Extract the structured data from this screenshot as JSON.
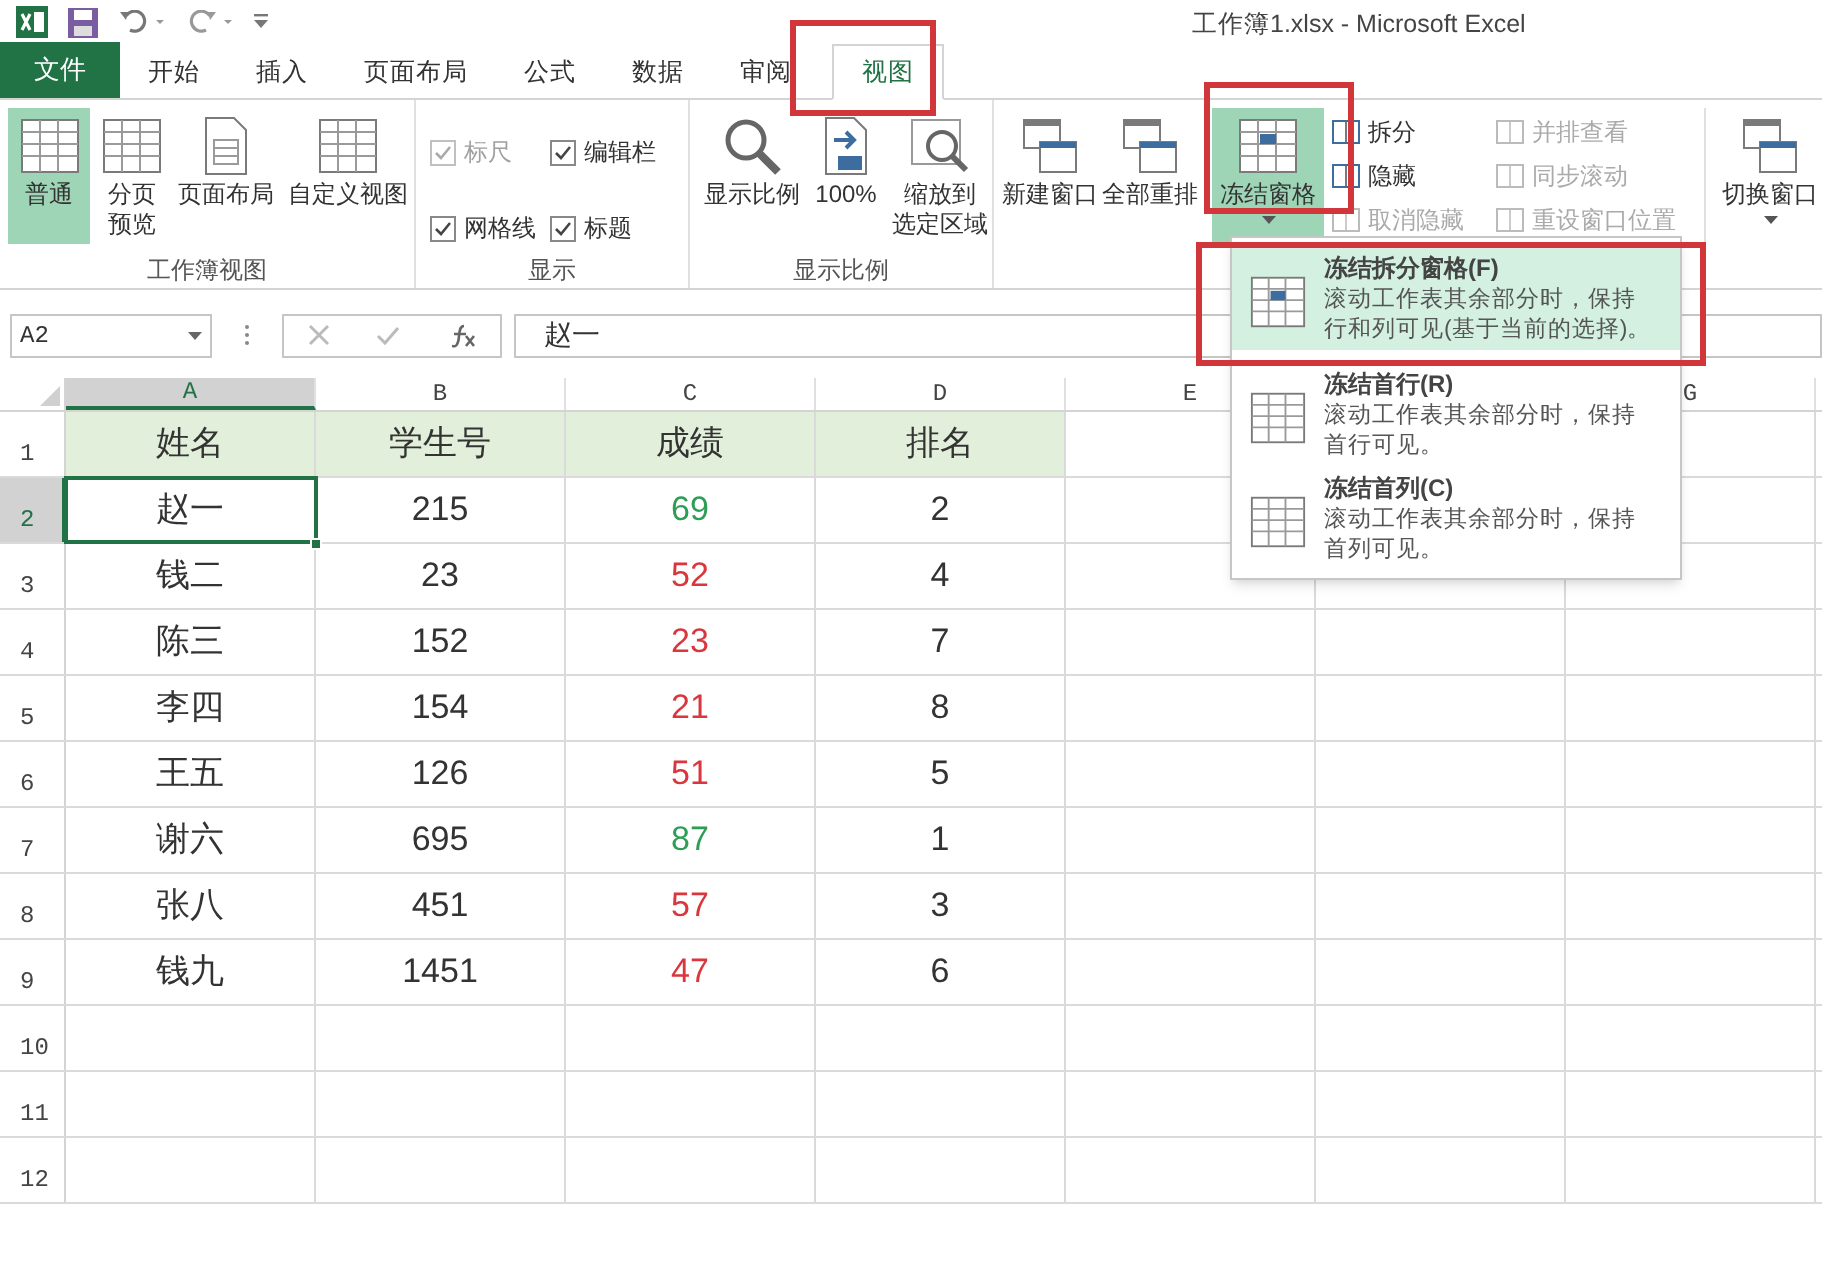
{
  "window": {
    "title": "工作簿1.xlsx - Microsoft Excel"
  },
  "tabs": [
    {
      "label": "文件",
      "kind": "file",
      "selected": false
    },
    {
      "label": "开始",
      "kind": "tab",
      "selected": false
    },
    {
      "label": "插入",
      "kind": "tab",
      "selected": false
    },
    {
      "label": "页面布局",
      "kind": "tab",
      "selected": false
    },
    {
      "label": "公式",
      "kind": "tab",
      "selected": false
    },
    {
      "label": "数据",
      "kind": "tab",
      "selected": false
    },
    {
      "label": "审阅",
      "kind": "tab",
      "selected": false
    },
    {
      "label": "视图",
      "kind": "tab",
      "selected": true
    }
  ],
  "ribbon": {
    "workbook_views": {
      "label": "工作簿视图",
      "buttons": [
        {
          "label": "普通",
          "selected": true
        },
        {
          "lines": [
            "分页",
            "预览"
          ],
          "selected": false
        },
        {
          "label": "页面布局",
          "selected": false
        },
        {
          "label": "自定义视图",
          "selected": false
        }
      ]
    },
    "show": {
      "label": "显示",
      "checkboxes": [
        {
          "label": "标尺",
          "checked": true,
          "disabled": true
        },
        {
          "label": "编辑栏",
          "checked": true,
          "disabled": false
        },
        {
          "label": "网格线",
          "checked": true,
          "disabled": false
        },
        {
          "label": "标题",
          "checked": true,
          "disabled": false
        }
      ]
    },
    "zoom": {
      "label": "显示比例",
      "buttons": [
        {
          "label": "显示比例"
        },
        {
          "label": "100%"
        },
        {
          "lines": [
            "缩放到",
            "选定区域"
          ]
        }
      ]
    },
    "window": {
      "buttons": [
        {
          "label": "新建窗口",
          "expanded": false
        },
        {
          "label": "全部重排",
          "expanded": false
        },
        {
          "label": "冻结窗格",
          "expanded": true
        }
      ],
      "small_left": [
        {
          "label": "拆分",
          "disabled": false
        },
        {
          "label": "隐藏",
          "disabled": false
        },
        {
          "label": "取消隐藏",
          "disabled": true
        }
      ],
      "small_right": [
        {
          "label": "并排查看",
          "disabled": true
        },
        {
          "label": "同步滚动",
          "disabled": true
        },
        {
          "label": "重设窗口位置",
          "disabled": true
        }
      ],
      "switch": {
        "label": "切换窗口"
      }
    }
  },
  "formula_bar": {
    "name_box": "A2",
    "value": "赵一"
  },
  "columns": [
    {
      "label": "A",
      "selected": true
    },
    {
      "label": "B",
      "selected": false
    },
    {
      "label": "C",
      "selected": false
    },
    {
      "label": "D",
      "selected": false
    },
    {
      "label": "E",
      "selected": false
    },
    {
      "label": "G",
      "selected": false
    }
  ],
  "rows": [
    {
      "row": "1",
      "kind": "header",
      "cells": [
        "姓名",
        "学生号",
        "成绩",
        "排名"
      ],
      "selected": false
    },
    {
      "row": "2",
      "kind": "data",
      "cells": [
        "赵一",
        "215",
        "69",
        "2"
      ],
      "color": "#2e9e57",
      "selected": true
    },
    {
      "row": "3",
      "kind": "data",
      "cells": [
        "钱二",
        "23",
        "52",
        "4"
      ],
      "color": "#d9363e",
      "selected": false
    },
    {
      "row": "4",
      "kind": "data",
      "cells": [
        "陈三",
        "152",
        "23",
        "7"
      ],
      "color": "#d9363e",
      "selected": false
    },
    {
      "row": "5",
      "kind": "data",
      "cells": [
        "李四",
        "154",
        "21",
        "8"
      ],
      "color": "#d9363e",
      "selected": false
    },
    {
      "row": "6",
      "kind": "data",
      "cells": [
        "王五",
        "126",
        "51",
        "5"
      ],
      "color": "#d9363e",
      "selected": false
    },
    {
      "row": "7",
      "kind": "data",
      "cells": [
        "谢六",
        "695",
        "87",
        "1"
      ],
      "color": "#2e9e57",
      "selected": false
    },
    {
      "row": "8",
      "kind": "data",
      "cells": [
        "张八",
        "451",
        "57",
        "3"
      ],
      "color": "#d9363e",
      "selected": false
    },
    {
      "row": "9",
      "kind": "data",
      "cells": [
        "钱九",
        "1451",
        "47",
        "6"
      ],
      "color": "#d9363e",
      "selected": false
    },
    {
      "row": "10",
      "kind": "empty",
      "selected": false
    },
    {
      "row": "11",
      "kind": "empty",
      "selected": false
    },
    {
      "row": "12",
      "kind": "empty",
      "selected": false
    }
  ],
  "freeze_menu": [
    {
      "title": "冻结拆分窗格(F)",
      "description": [
        "滚动工作表其余部分时，保持",
        "行和列可见(基于当前的选择)。"
      ],
      "selected": true
    },
    {
      "title": "冻结首行(R)",
      "description": [
        "滚动工作表其余部分时，保持",
        "首行可见。"
      ],
      "selected": false
    },
    {
      "title": "冻结首列(C)",
      "description": [
        "滚动工作表其余部分时，保持",
        "首列可见。"
      ],
      "selected": false
    }
  ]
}
